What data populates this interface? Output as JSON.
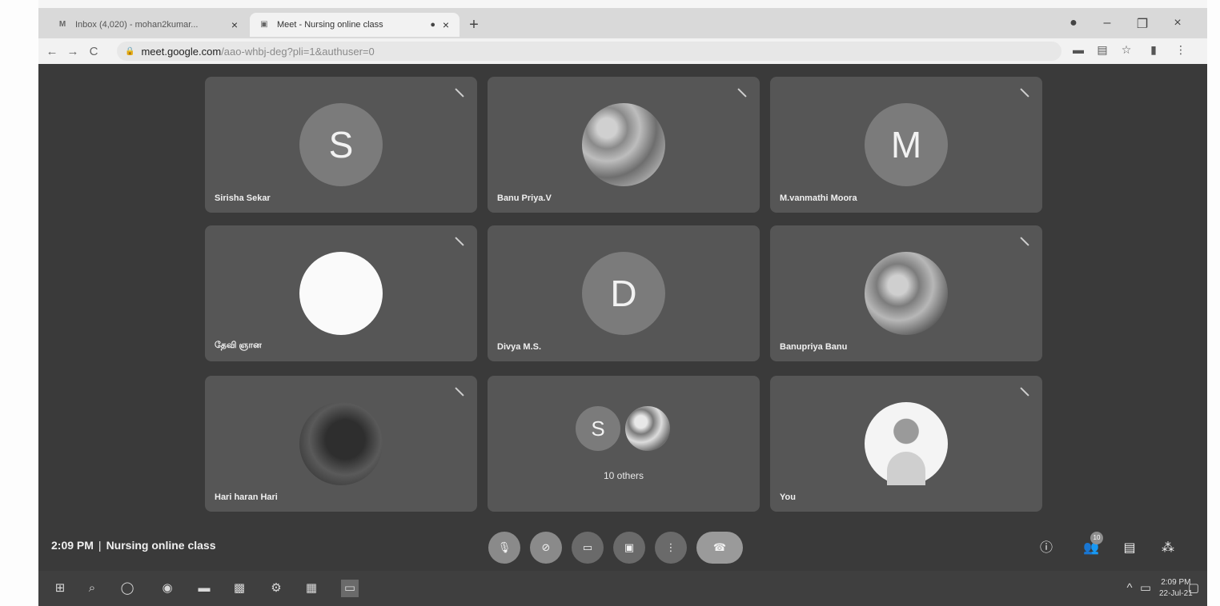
{
  "browser": {
    "tabs": [
      {
        "label": "Inbox (4,020) - mohan2kumar...",
        "favicon": "M",
        "active": false
      },
      {
        "label": "Meet - Nursing online class",
        "favicon": "▣",
        "active": true
      }
    ],
    "url_host": "meet.google.com",
    "url_path": "/aao-whbj-deg?pli=1&authuser=0"
  },
  "participants": [
    {
      "name": "Sirisha Sekar",
      "avatar_type": "letter",
      "initial": "S"
    },
    {
      "name": "Banu Priya.V",
      "avatar_type": "photo-art",
      "initial": ""
    },
    {
      "name": "M.vanmathi Moora",
      "avatar_type": "letter",
      "initial": "M"
    },
    {
      "name": "தேவி ஞான",
      "avatar_type": "photo-white",
      "initial": ""
    },
    {
      "name": "Divya M.S.",
      "avatar_type": "letter",
      "initial": "D"
    },
    {
      "name": "Banupriya Banu",
      "avatar_type": "photo-flower",
      "initial": ""
    },
    {
      "name": "Hari haran Hari",
      "avatar_type": "photo-dark",
      "initial": ""
    },
    {
      "name": "",
      "avatar_type": "others",
      "initial": "S"
    },
    {
      "name": "You",
      "avatar_type": "photo-you",
      "initial": ""
    }
  ],
  "others_label": "10 others",
  "meeting": {
    "time": "2:09 PM",
    "separator": "|",
    "title": "Nursing online class"
  },
  "people_count": "10",
  "taskbar": {
    "time": "2:09 PM",
    "date": "22-Jul-21"
  }
}
